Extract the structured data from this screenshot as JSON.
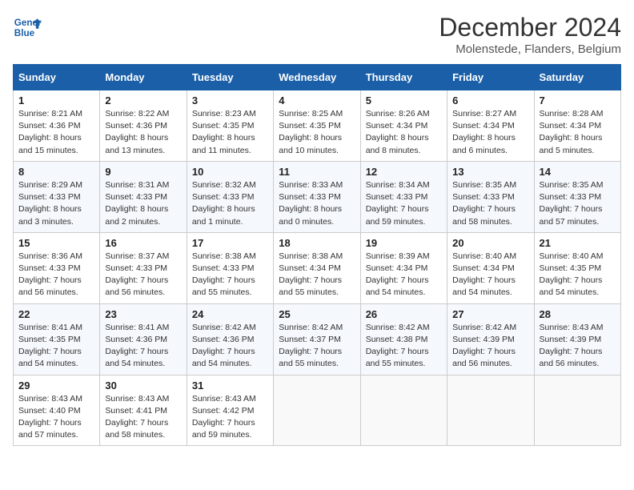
{
  "header": {
    "logo_line1": "General",
    "logo_line2": "Blue",
    "main_title": "December 2024",
    "subtitle": "Molenstede, Flanders, Belgium"
  },
  "weekdays": [
    "Sunday",
    "Monday",
    "Tuesday",
    "Wednesday",
    "Thursday",
    "Friday",
    "Saturday"
  ],
  "weeks": [
    [
      {
        "day": "1",
        "info": "Sunrise: 8:21 AM\nSunset: 4:36 PM\nDaylight: 8 hours\nand 15 minutes."
      },
      {
        "day": "2",
        "info": "Sunrise: 8:22 AM\nSunset: 4:36 PM\nDaylight: 8 hours\nand 13 minutes."
      },
      {
        "day": "3",
        "info": "Sunrise: 8:23 AM\nSunset: 4:35 PM\nDaylight: 8 hours\nand 11 minutes."
      },
      {
        "day": "4",
        "info": "Sunrise: 8:25 AM\nSunset: 4:35 PM\nDaylight: 8 hours\nand 10 minutes."
      },
      {
        "day": "5",
        "info": "Sunrise: 8:26 AM\nSunset: 4:34 PM\nDaylight: 8 hours\nand 8 minutes."
      },
      {
        "day": "6",
        "info": "Sunrise: 8:27 AM\nSunset: 4:34 PM\nDaylight: 8 hours\nand 6 minutes."
      },
      {
        "day": "7",
        "info": "Sunrise: 8:28 AM\nSunset: 4:34 PM\nDaylight: 8 hours\nand 5 minutes."
      }
    ],
    [
      {
        "day": "8",
        "info": "Sunrise: 8:29 AM\nSunset: 4:33 PM\nDaylight: 8 hours\nand 3 minutes."
      },
      {
        "day": "9",
        "info": "Sunrise: 8:31 AM\nSunset: 4:33 PM\nDaylight: 8 hours\nand 2 minutes."
      },
      {
        "day": "10",
        "info": "Sunrise: 8:32 AM\nSunset: 4:33 PM\nDaylight: 8 hours\nand 1 minute."
      },
      {
        "day": "11",
        "info": "Sunrise: 8:33 AM\nSunset: 4:33 PM\nDaylight: 8 hours\nand 0 minutes."
      },
      {
        "day": "12",
        "info": "Sunrise: 8:34 AM\nSunset: 4:33 PM\nDaylight: 7 hours\nand 59 minutes."
      },
      {
        "day": "13",
        "info": "Sunrise: 8:35 AM\nSunset: 4:33 PM\nDaylight: 7 hours\nand 58 minutes."
      },
      {
        "day": "14",
        "info": "Sunrise: 8:35 AM\nSunset: 4:33 PM\nDaylight: 7 hours\nand 57 minutes."
      }
    ],
    [
      {
        "day": "15",
        "info": "Sunrise: 8:36 AM\nSunset: 4:33 PM\nDaylight: 7 hours\nand 56 minutes."
      },
      {
        "day": "16",
        "info": "Sunrise: 8:37 AM\nSunset: 4:33 PM\nDaylight: 7 hours\nand 56 minutes."
      },
      {
        "day": "17",
        "info": "Sunrise: 8:38 AM\nSunset: 4:33 PM\nDaylight: 7 hours\nand 55 minutes."
      },
      {
        "day": "18",
        "info": "Sunrise: 8:38 AM\nSunset: 4:34 PM\nDaylight: 7 hours\nand 55 minutes."
      },
      {
        "day": "19",
        "info": "Sunrise: 8:39 AM\nSunset: 4:34 PM\nDaylight: 7 hours\nand 54 minutes."
      },
      {
        "day": "20",
        "info": "Sunrise: 8:40 AM\nSunset: 4:34 PM\nDaylight: 7 hours\nand 54 minutes."
      },
      {
        "day": "21",
        "info": "Sunrise: 8:40 AM\nSunset: 4:35 PM\nDaylight: 7 hours\nand 54 minutes."
      }
    ],
    [
      {
        "day": "22",
        "info": "Sunrise: 8:41 AM\nSunset: 4:35 PM\nDaylight: 7 hours\nand 54 minutes."
      },
      {
        "day": "23",
        "info": "Sunrise: 8:41 AM\nSunset: 4:36 PM\nDaylight: 7 hours\nand 54 minutes."
      },
      {
        "day": "24",
        "info": "Sunrise: 8:42 AM\nSunset: 4:36 PM\nDaylight: 7 hours\nand 54 minutes."
      },
      {
        "day": "25",
        "info": "Sunrise: 8:42 AM\nSunset: 4:37 PM\nDaylight: 7 hours\nand 55 minutes."
      },
      {
        "day": "26",
        "info": "Sunrise: 8:42 AM\nSunset: 4:38 PM\nDaylight: 7 hours\nand 55 minutes."
      },
      {
        "day": "27",
        "info": "Sunrise: 8:42 AM\nSunset: 4:39 PM\nDaylight: 7 hours\nand 56 minutes."
      },
      {
        "day": "28",
        "info": "Sunrise: 8:43 AM\nSunset: 4:39 PM\nDaylight: 7 hours\nand 56 minutes."
      }
    ],
    [
      {
        "day": "29",
        "info": "Sunrise: 8:43 AM\nSunset: 4:40 PM\nDaylight: 7 hours\nand 57 minutes."
      },
      {
        "day": "30",
        "info": "Sunrise: 8:43 AM\nSunset: 4:41 PM\nDaylight: 7 hours\nand 58 minutes."
      },
      {
        "day": "31",
        "info": "Sunrise: 8:43 AM\nSunset: 4:42 PM\nDaylight: 7 hours\nand 59 minutes."
      },
      null,
      null,
      null,
      null
    ]
  ]
}
